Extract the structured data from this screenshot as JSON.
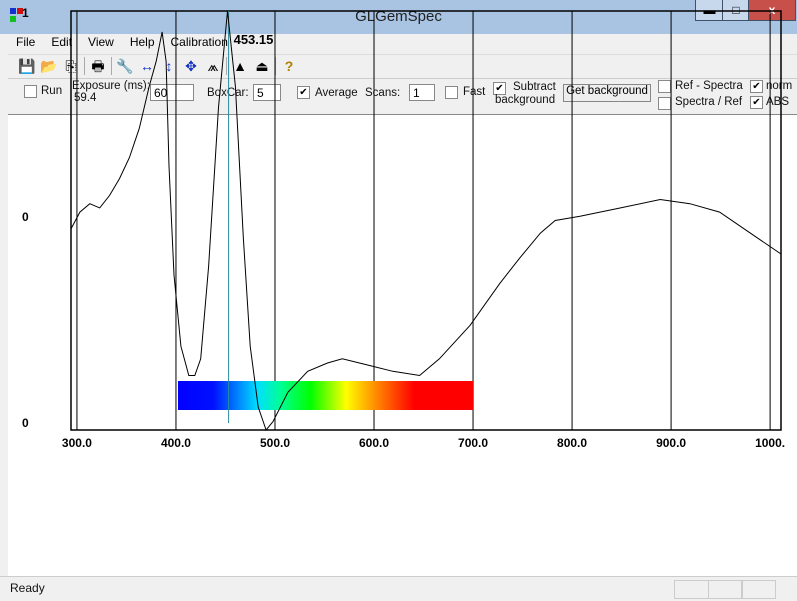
{
  "window": {
    "title": "GLGemSpec",
    "minimize": "▬",
    "maximize": "□",
    "close": "x"
  },
  "menu": [
    "File",
    "Edit",
    "View",
    "Help",
    "Calibration"
  ],
  "toolbar": [
    {
      "icon": "save-icon",
      "glyph": "💾"
    },
    {
      "icon": "open-folder-icon",
      "glyph": "📂"
    },
    {
      "icon": "copy-icon",
      "glyph": "⎘"
    },
    {
      "sep": true
    },
    {
      "icon": "print-icon",
      "glyph": "🖶"
    },
    {
      "sep": true
    },
    {
      "icon": "wrench-icon",
      "glyph": "🔧"
    },
    {
      "icon": "horizontal-arrows-icon",
      "glyph": "↔"
    },
    {
      "icon": "vertical-arrows-icon",
      "glyph": "↕"
    },
    {
      "icon": "move-arrows-icon",
      "glyph": "✥"
    },
    {
      "icon": "chart-icon",
      "glyph": "⩕"
    },
    {
      "sep": true
    },
    {
      "icon": "spectrum-down-icon",
      "glyph": "▲"
    },
    {
      "icon": "spectrum-folder-icon",
      "glyph": "⏏"
    },
    {
      "sep": true
    },
    {
      "icon": "help-icon",
      "glyph": "?"
    }
  ],
  "controls": {
    "run": {
      "label": "Run",
      "checked": false
    },
    "exposure_label": "Exposure (ms):",
    "exposure_actual": "59.4",
    "exposure_value": "60",
    "boxcar_label": "BoxCar:",
    "boxcar_value": "5",
    "average": {
      "label": "Average",
      "checked": true
    },
    "scans_label": "Scans:",
    "scans_value": "1",
    "fast": {
      "label": "Fast",
      "checked": false
    },
    "subtract": {
      "label1": "Subtract",
      "label2": "background",
      "checked": true
    },
    "get_background": "Get background",
    "ref_minus": {
      "label": "Ref - Spectra",
      "checked": false
    },
    "spectra_div": {
      "label": "Spectra / Ref",
      "checked": false
    },
    "norm": {
      "label": "norm",
      "checked": true
    },
    "abs": {
      "label": "ABS",
      "checked": true
    }
  },
  "chart_data": {
    "type": "line",
    "xlim": [
      294,
      1011
    ],
    "ylim": [
      0,
      1
    ],
    "y_tick_labels": [
      "1",
      "0",
      "0"
    ],
    "x_tick_labels": [
      "300.0",
      "400.0",
      "500.0",
      "600.0",
      "700.0",
      "800.0",
      "900.0",
      "1000."
    ],
    "x_ticks": [
      300,
      400,
      500,
      600,
      700,
      800,
      900,
      1000
    ],
    "marker": {
      "x": 453.15,
      "label": "453.15",
      "color": "#2a8a9a"
    },
    "spectrum_band": [
      400,
      700
    ],
    "x": [
      294,
      303,
      313,
      323,
      333,
      343,
      353,
      363,
      373,
      380,
      386,
      390,
      393,
      398,
      405,
      413,
      419,
      425,
      433,
      443,
      452,
      460,
      468,
      475,
      483,
      491,
      498,
      513,
      533,
      553,
      568,
      594,
      619,
      646,
      666,
      697,
      727,
      747,
      768,
      783,
      808,
      849,
      889,
      919,
      949,
      980,
      1011
    ],
    "y": [
      0.48,
      0.52,
      0.54,
      0.53,
      0.56,
      0.6,
      0.65,
      0.72,
      0.82,
      0.88,
      0.95,
      0.88,
      0.63,
      0.37,
      0.2,
      0.13,
      0.13,
      0.17,
      0.39,
      0.77,
      1.0,
      0.82,
      0.46,
      0.2,
      0.055,
      0,
      0.02,
      0.09,
      0.14,
      0.16,
      0.17,
      0.155,
      0.14,
      0.13,
      0.17,
      0.25,
      0.35,
      0.41,
      0.47,
      0.5,
      0.51,
      0.53,
      0.55,
      0.54,
      0.52,
      0.47,
      0.42
    ]
  },
  "status": {
    "text": "Ready"
  }
}
